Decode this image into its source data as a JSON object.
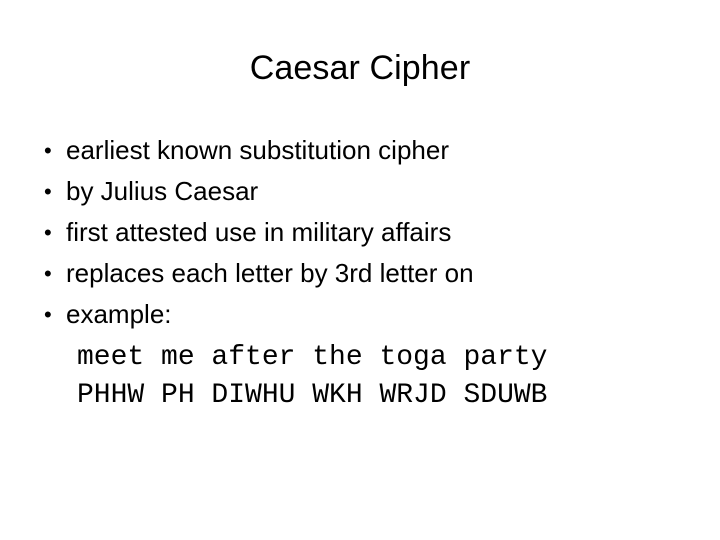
{
  "slide": {
    "title": "Caesar Cipher",
    "background_color": "#ffffff",
    "text_color": "#000000"
  },
  "bullets": [
    {
      "marker": "•",
      "text": "earliest known substitution cipher"
    },
    {
      "marker": "•",
      "text": "by Julius Caesar"
    },
    {
      "marker": "•",
      "text": "first attested use in military affairs"
    },
    {
      "marker": "•",
      "text": "replaces each letter by 3rd letter on"
    },
    {
      "marker": "•",
      "text": "example:"
    }
  ],
  "example": {
    "plaintext": "meet me after the toga party",
    "ciphertext": "PHHW PH DIWHU WKH WRJD SDUWB"
  }
}
